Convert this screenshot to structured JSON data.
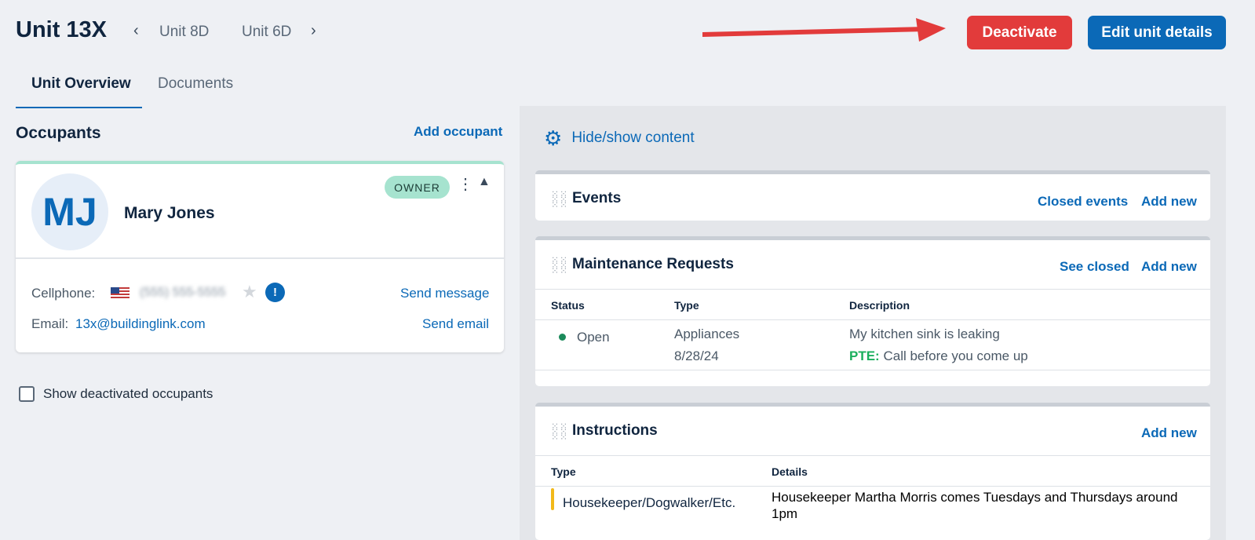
{
  "header": {
    "unit_title": "Unit 13X",
    "prev_unit": "Unit 8D",
    "next_unit": "Unit 6D",
    "deactivate_label": "Deactivate",
    "edit_label": "Edit unit details"
  },
  "tabs": [
    {
      "label": "Unit Overview",
      "active": true
    },
    {
      "label": "Documents",
      "active": false
    }
  ],
  "occupants": {
    "title": "Occupants",
    "add_label": "Add occupant",
    "card": {
      "initials": "MJ",
      "name": "Mary Jones",
      "badge": "OWNER",
      "cellphone_label": "Cellphone:",
      "cellphone_value": "(555) 555-5555",
      "email_label": "Email:",
      "email_value": "13x@buildinglink.com",
      "send_message": "Send message",
      "send_email": "Send email"
    },
    "show_deactivated": "Show deactivated occupants"
  },
  "right": {
    "hide_show": "Hide/show content",
    "events": {
      "title": "Events",
      "closed_link": "Closed events",
      "add_link": "Add new"
    },
    "maintenance": {
      "title": "Maintenance Requests",
      "closed_link": "See closed",
      "add_link": "Add new",
      "columns": [
        "Status",
        "Type",
        "Description"
      ],
      "rows": [
        {
          "status": "Open",
          "type": "Appliances",
          "date": "8/28/24",
          "description": "My kitchen sink is leaking",
          "pte_label": "PTE:",
          "pte_text": "Call before you come up"
        }
      ]
    },
    "instructions": {
      "title": "Instructions",
      "add_link": "Add new",
      "columns": [
        "Type",
        "Details"
      ],
      "rows": [
        {
          "type": "Housekeeper/Dogwalker/Etc.",
          "details_line1": "Housekeeper Martha Morris comes Tuesdays and Thursdays around",
          "details_line2": "1pm"
        }
      ]
    }
  },
  "colors": {
    "accent": "#0b69b7",
    "danger": "#e23b3b",
    "owner_badge": "#a6e3cf",
    "status_open": "#1b8a5a",
    "pte": "#1aaf5d",
    "instruction_marker": "#f2b91a"
  }
}
